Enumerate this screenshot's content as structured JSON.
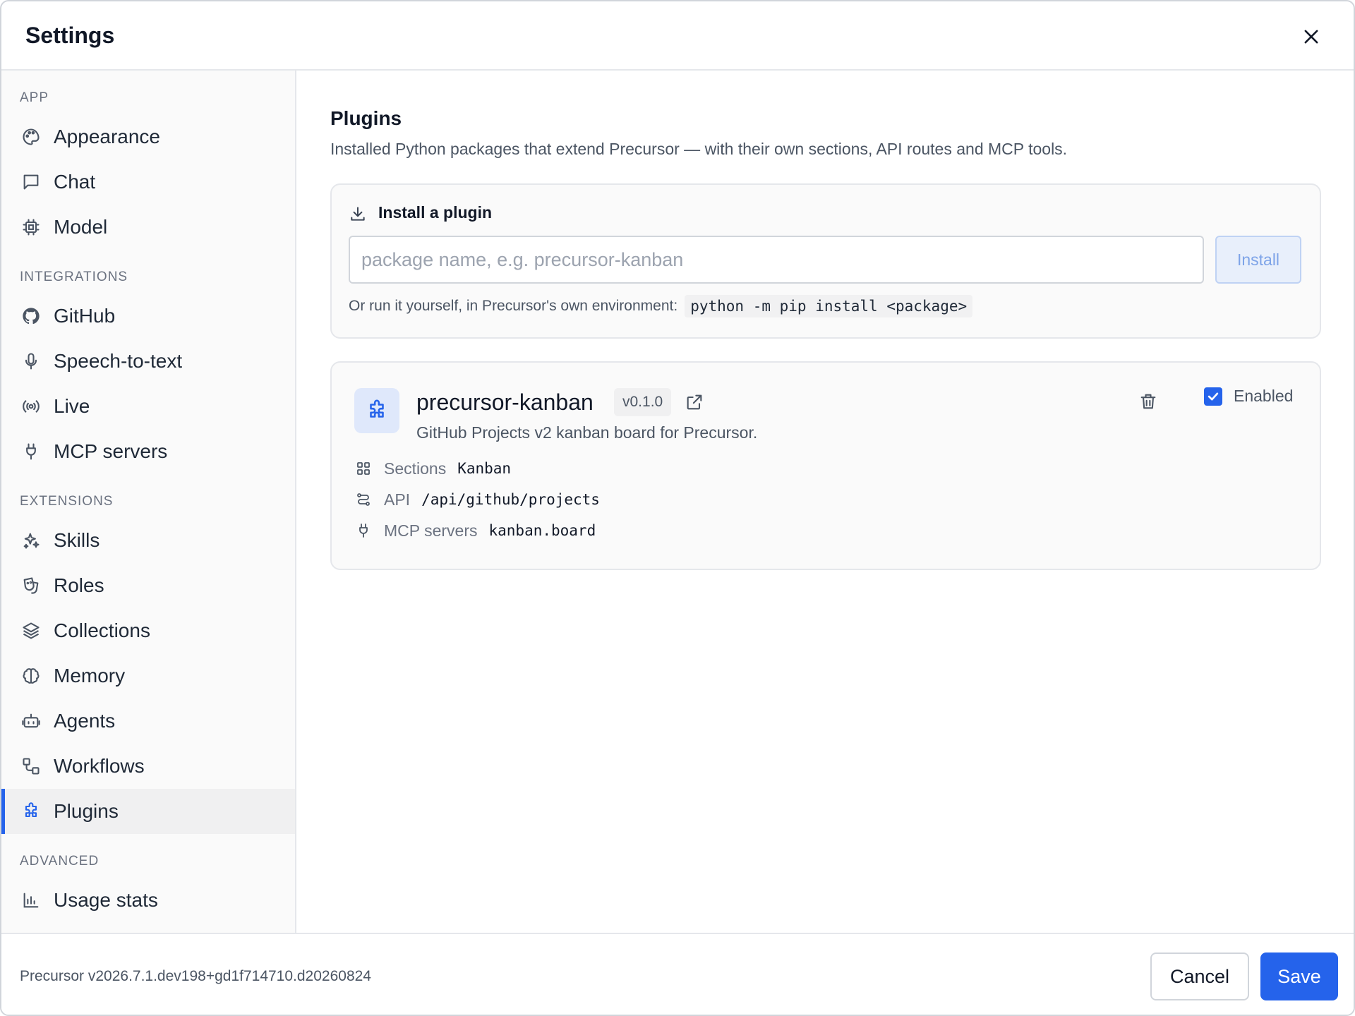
{
  "window": {
    "title": "Settings"
  },
  "sidebar": {
    "sections": {
      "app": "APP",
      "integrations": "INTEGRATIONS",
      "extensions": "EXTENSIONS",
      "advanced": "ADVANCED"
    },
    "items": [
      {
        "label": "Appearance",
        "icon": "palette-icon"
      },
      {
        "label": "Chat",
        "icon": "chat-bubble-icon"
      },
      {
        "label": "Model",
        "icon": "cpu-chip-icon"
      },
      {
        "label": "GitHub",
        "icon": "github-icon"
      },
      {
        "label": "Speech-to-text",
        "icon": "microphone-icon"
      },
      {
        "label": "Live",
        "icon": "broadcast-icon"
      },
      {
        "label": "MCP servers",
        "icon": "plug-icon"
      },
      {
        "label": "Skills",
        "icon": "sparkles-icon"
      },
      {
        "label": "Roles",
        "icon": "theater-masks-icon"
      },
      {
        "label": "Collections",
        "icon": "layers-icon"
      },
      {
        "label": "Memory",
        "icon": "brain-icon"
      },
      {
        "label": "Agents",
        "icon": "robot-icon"
      },
      {
        "label": "Workflows",
        "icon": "workflow-icon"
      },
      {
        "label": "Plugins",
        "icon": "puzzle-icon",
        "active": true
      },
      {
        "label": "Usage stats",
        "icon": "bar-chart-icon"
      }
    ]
  },
  "main": {
    "title": "Plugins",
    "subtitle": "Installed Python packages that extend Precursor — with their own sections, API routes and MCP tools.",
    "install": {
      "title": "Install a plugin",
      "placeholder": "package name, e.g. precursor-kanban",
      "value": "",
      "button": "Install",
      "hint": "Or run it yourself, in Precursor's own environment:",
      "command": "python -m pip install <package>"
    },
    "plugin": {
      "name": "precursor-kanban",
      "version": "v0.1.0",
      "description": "GitHub Projects v2 kanban board for Precursor.",
      "enabled_label": "Enabled",
      "enabled": true,
      "meta": [
        {
          "label": "Sections",
          "value": "Kanban",
          "icon": "grid-icon"
        },
        {
          "label": "API",
          "value": "/api/github/projects",
          "icon": "route-icon"
        },
        {
          "label": "MCP servers",
          "value": "kanban.board",
          "icon": "plug-icon"
        }
      ]
    }
  },
  "footer": {
    "version": "Precursor v2026.7.1.dev198+gd1f714710.d20260824",
    "cancel": "Cancel",
    "save": "Save"
  },
  "colors": {
    "accent": "#2563eb",
    "border": "#e5e7eb",
    "sidebar_active_bg": "#f0f0f1"
  }
}
